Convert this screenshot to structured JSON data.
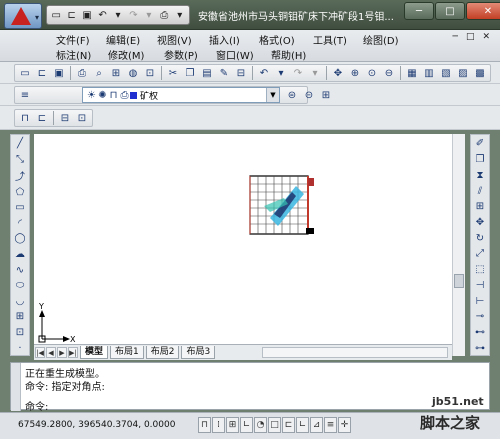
{
  "window": {
    "title": "安徽省池州市马头铜钼矿床下冲矿段1号钼...",
    "controls": {
      "minimize": "─",
      "maximize": "□",
      "close": "✕"
    }
  },
  "quick_access": [
    "new-icon",
    "open-icon",
    "save-icon",
    "undo-icon",
    "redo-icon",
    "plot-icon",
    "dropdown-icon"
  ],
  "menubar": {
    "row1": [
      "文件(F)",
      "编辑(E)",
      "视图(V)",
      "插入(I)",
      "格式(O)",
      "工具(T)",
      "绘图(D)"
    ],
    "row2": [
      "标注(N)",
      "修改(M)",
      "参数(P)",
      "窗口(W)",
      "帮助(H)"
    ],
    "mdi_controls": [
      "─",
      "□",
      "✕"
    ]
  },
  "layer": {
    "current": "矿权",
    "color": "#1f2fd0"
  },
  "layout_tabs": [
    "模型",
    "布局1",
    "布局2",
    "布局3"
  ],
  "active_tab": "模型",
  "command": {
    "lines": [
      "正在重生成模型。",
      "命令: 指定对角点:"
    ],
    "prompt": "命令:"
  },
  "status": {
    "coords": "67549.2800, 396540.3704, 0.0000"
  },
  "watermark": {
    "url": "jb51.net",
    "text": "脚本之家"
  },
  "ucs": {
    "x": "X",
    "y": "Y"
  }
}
